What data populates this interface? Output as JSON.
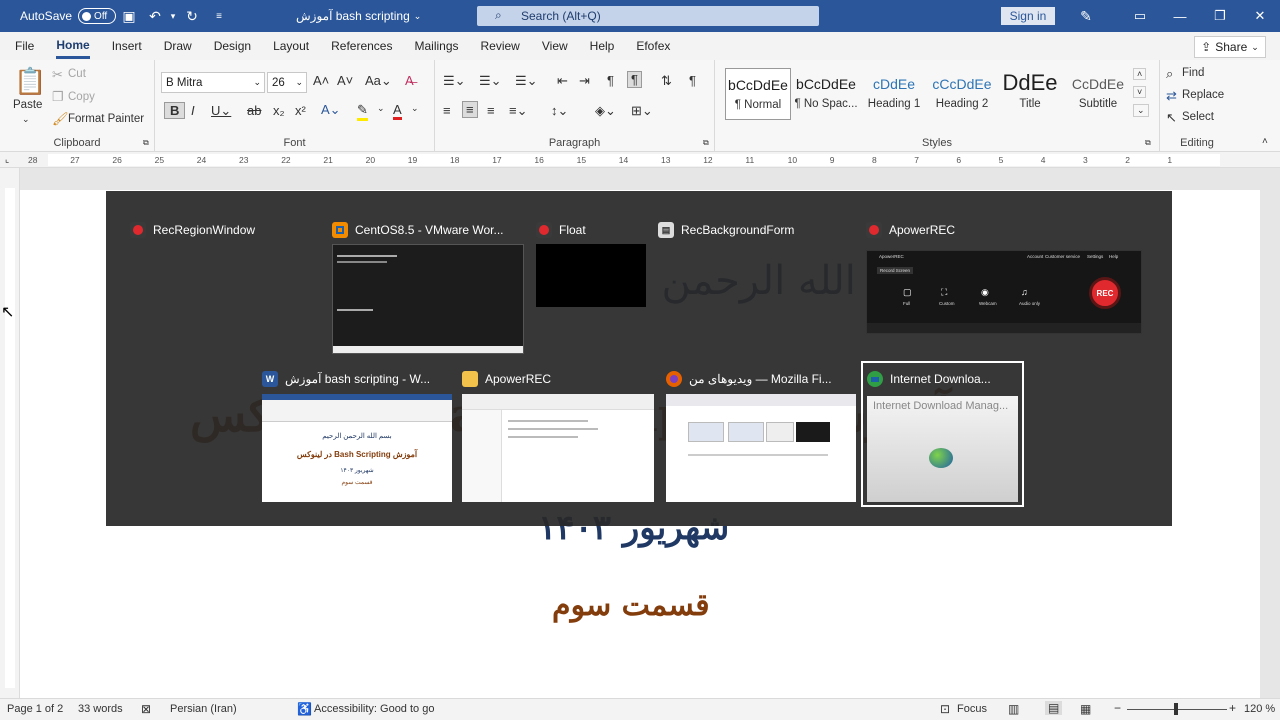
{
  "titlebar": {
    "autosave_label": "AutoSave",
    "autosave_state": "Off",
    "doc_title": "آموزش bash scripting",
    "search_placeholder": "Search (Alt+Q)",
    "signin_label": "Sign in"
  },
  "tabs": [
    "File",
    "Home",
    "Insert",
    "Draw",
    "Design",
    "Layout",
    "References",
    "Mailings",
    "Review",
    "View",
    "Help",
    "Efofex"
  ],
  "share_label": "Share",
  "clipboard": {
    "paste": "Paste",
    "cut": "Cut",
    "copy": "Copy",
    "format_painter": "Format Painter",
    "label": "Clipboard"
  },
  "font": {
    "name": "B Mitra",
    "size": "26",
    "label": "Font"
  },
  "paragraph": {
    "label": "Paragraph"
  },
  "styles": {
    "label": "Styles",
    "items": [
      {
        "sample": "bCcDdEe",
        "name": "¶ Normal"
      },
      {
        "sample": "bCcDdEe",
        "name": "¶ No Spac..."
      },
      {
        "sample": "cDdEe",
        "name": "Heading 1"
      },
      {
        "sample": "cCcDdEe",
        "name": "Heading 2"
      },
      {
        "sample": "DdEe",
        "name": "Title"
      },
      {
        "sample": "CcDdEe",
        "name": "Subtitle"
      }
    ]
  },
  "editing": {
    "find": "Find",
    "replace": "Replace",
    "select": "Select",
    "label": "Editing"
  },
  "ruler_numbers": [
    "28",
    "27",
    "26",
    "25",
    "24",
    "23",
    "22",
    "21",
    "20",
    "19",
    "18",
    "17",
    "16",
    "15",
    "14",
    "13",
    "12",
    "11",
    "10",
    "9",
    "8",
    "7",
    "6",
    "5",
    "4",
    "3",
    "2",
    "1"
  ],
  "document": {
    "line1": "بسم الله الرحمن الرحیم",
    "line2": "آموزش Bash Scripting در لینوکس",
    "line3": "شهریور ۱۴۰۳",
    "line4": "قسمت سوم"
  },
  "switcher": {
    "row1": [
      {
        "title": "RecRegionWindow",
        "icon": "record-icon"
      },
      {
        "title": "CentOS8.5 - VMware Wor...",
        "icon": "vmware-icon"
      },
      {
        "title": "Float",
        "icon": "record-icon"
      },
      {
        "title": "RecBackgroundForm",
        "icon": "window-icon"
      },
      {
        "title": "ApowerREC",
        "icon": "record-icon"
      }
    ],
    "row2": [
      {
        "title": "آموزش bash scripting - W...",
        "icon": "word-icon"
      },
      {
        "title": "ApowerREC",
        "icon": "folder-icon"
      },
      {
        "title": "ویدیوهای من — Mozilla Fi...",
        "icon": "firefox-icon"
      },
      {
        "title": "Internet Downloa...",
        "icon": "idm-icon"
      }
    ],
    "apower_thumb": {
      "app_name": "ApowerREC",
      "menu": [
        "Account",
        "Customer service",
        "Settings",
        "Help"
      ],
      "tab": "Record Screen",
      "options": [
        "Full",
        "Custom",
        "Webcam",
        "Audio only"
      ],
      "rec_label": "REC"
    },
    "idm_thumb_text": "Internet Download Manag..."
  },
  "status": {
    "page": "Page 1 of 2",
    "words": "33 words",
    "language": "Persian (Iran)",
    "accessibility": "Accessibility: Good to go",
    "focus": "Focus",
    "zoom": "120 %"
  }
}
